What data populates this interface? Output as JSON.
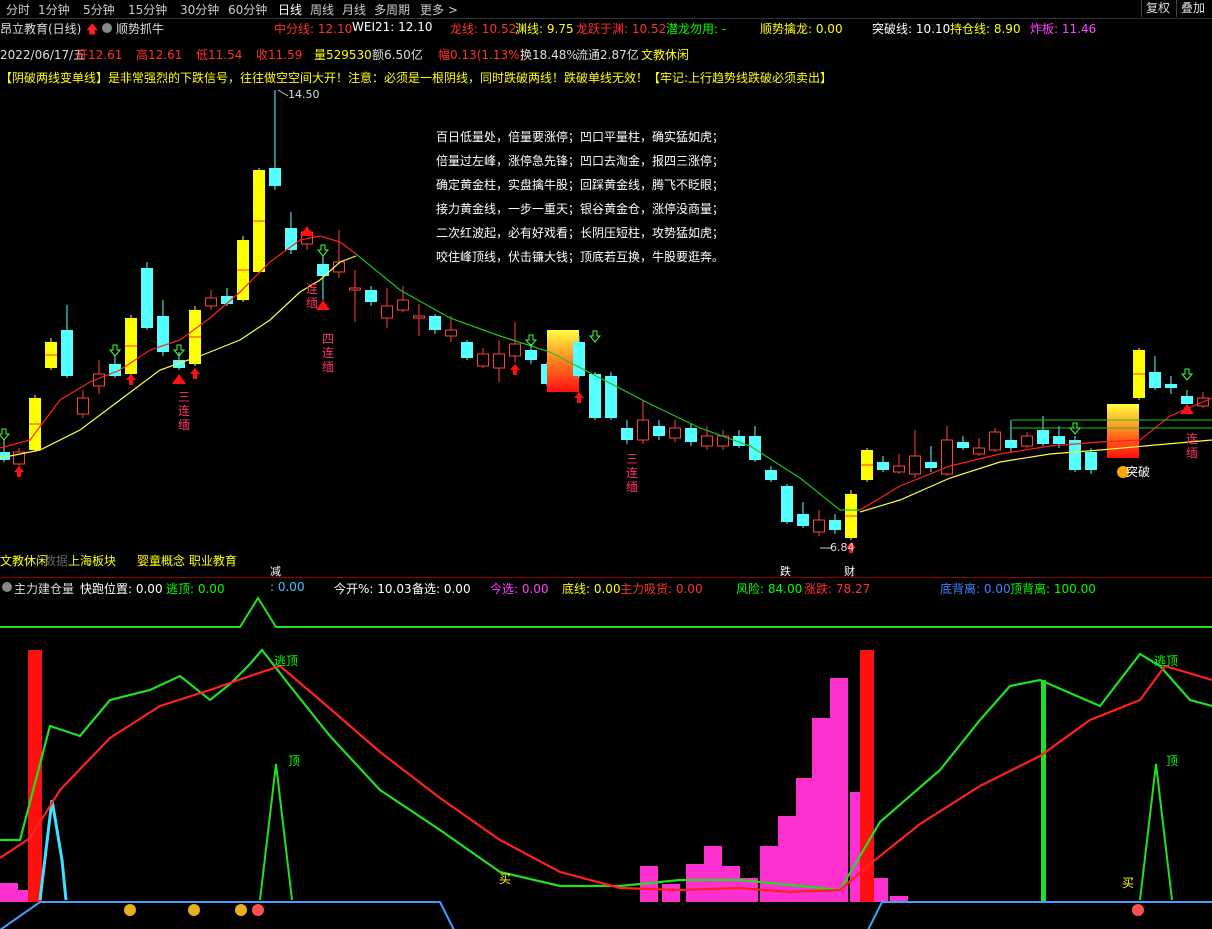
{
  "topbar": {
    "timeframes": [
      "分时",
      "1分钟",
      "5分钟",
      "15分钟",
      "30分钟",
      "60分钟",
      "日线",
      "周线",
      "月线",
      "多周期",
      "更多 >"
    ],
    "active": "日线",
    "right_buttons": [
      "复权",
      "叠加"
    ]
  },
  "header": {
    "stock": "昂立教育(日线)",
    "strategy": "顺势抓牛",
    "ind": [
      {
        "label": "中分线: 12.10",
        "color": "#ff3030"
      },
      {
        "label": "WEI21: 12.10",
        "color": "#ffffff"
      },
      {
        "label": "龙线: 10.52",
        "color": "#ff3030"
      },
      {
        "label": "渊线: 9.75",
        "color": "#ffff00"
      },
      {
        "label": "龙跃于渊: 10.52",
        "color": "#ff3030"
      },
      {
        "label": "潜龙勿用: -",
        "color": "#00ff00"
      },
      {
        "label": "顺势擒龙: 0.00",
        "color": "#ffff00"
      },
      {
        "label": "突破线: 10.10",
        "color": "#ffffff"
      },
      {
        "label": "持仓线: 8.90",
        "color": "#ffff00"
      },
      {
        "label": "炸板: 11.46",
        "color": "#ff40ff"
      }
    ]
  },
  "quote": {
    "date": "2022/06/17/五",
    "items": [
      {
        "label": "开12.61",
        "color": "#ff3030"
      },
      {
        "label": "高12.61",
        "color": "#ff3030"
      },
      {
        "label": "低11.54",
        "color": "#ff3030"
      },
      {
        "label": "收11.59",
        "color": "#ff3030"
      },
      {
        "label": "量529530",
        "color": "#ffff00"
      },
      {
        "label": "额6.50亿",
        "color": "#dddddd"
      },
      {
        "label": "幅0.13(1.13%)",
        "color": "#ff3030"
      },
      {
        "label": "换18.48%",
        "color": "#dddddd"
      },
      {
        "label": "流通2.87亿",
        "color": "#dddddd"
      },
      {
        "label": "文教休闲",
        "color": "#ffff00"
      }
    ]
  },
  "notice": "【阴破两线变单线】是非常强烈的下跌信号，往往做空空间大开！注意：必须是一根阴线，同时跌破两线！跌破单线无效！【牢记:上行趋势线跌破必须卖出】",
  "poem": [
    "百日低量处，倍量要涨停；凹口平量柱，确实猛如虎；",
    "倍量过左峰，涨停急先锋；凹口去淘金，报四三涨停；",
    "确定黄金柱，实盘擒牛股；回踩黄金线，腾飞不眨眼；",
    "接力黄金线，一步一重天；银谷黄金仓，涨停没商量；",
    "二次红波起，必有好戏看；长阴压短柱，攻势猛如虎；",
    "咬住峰顶线，伏击镰大钱；顶底若互换，牛股要逛奔。"
  ],
  "price_labels": {
    "high": "14.50",
    "low": "6.84"
  },
  "annotations": {
    "lian3a": "三连缅",
    "lian2": "连缅",
    "lian4": "四连缅",
    "lian3b": "三连缅",
    "lian_r": "连缅",
    "tupo": "突破"
  },
  "sector": {
    "a": "文教休闲",
    "b": "数据",
    "c": "上海板块",
    "d": "婴童概念 职业教育"
  },
  "markers": {
    "jian": "减",
    "die": "跌",
    "cai": "财"
  },
  "sub": {
    "title": "主力建仓量",
    "items": [
      {
        "label": "快跑位置: 0.00",
        "color": "#ffffff"
      },
      {
        "label": "逃顶: 0.00",
        "color": "#00ff00"
      },
      {
        "label": ": 0.00",
        "color": "#40c0ff"
      },
      {
        "label": "今开%: 10.03",
        "color": "#ffffff"
      },
      {
        "label": "备选: 0.00",
        "color": "#ffffff"
      },
      {
        "label": "今选: 0.00",
        "color": "#ff40ff"
      },
      {
        "label": "底线: 0.00",
        "color": "#ffff00"
      },
      {
        "label": "主力吸货: 0.00",
        "color": "#ff3030"
      },
      {
        "label": "风险: 84.00",
        "color": "#00ff00"
      },
      {
        "label": "涨跌: 78.27",
        "color": "#ff3030"
      },
      {
        "label": "底背离: 0.00",
        "color": "#4080ff"
      },
      {
        "label": "顶背离: 100.00",
        "color": "#00ff00"
      }
    ],
    "labels": {
      "escape": "逃顶",
      "top": "顶",
      "buy": "买"
    }
  }
}
